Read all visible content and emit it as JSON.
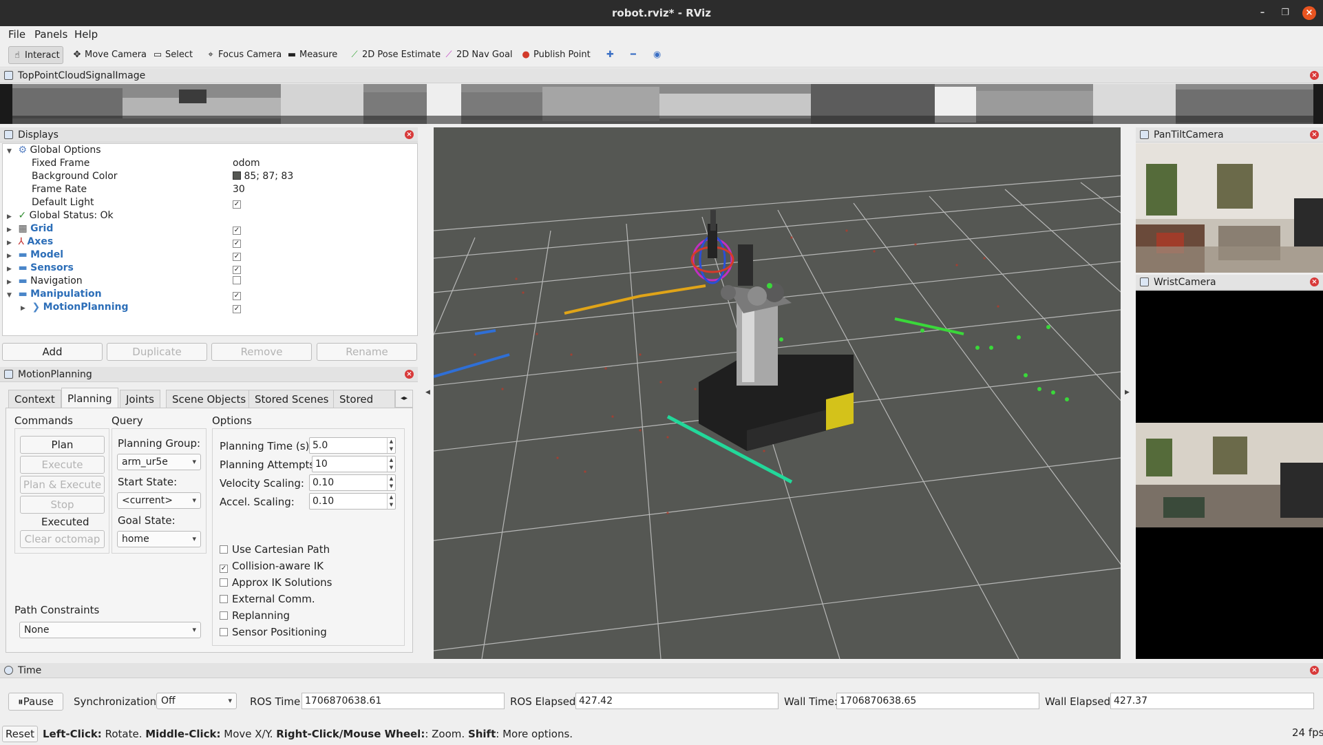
{
  "window": {
    "title": "robot.rviz* - RViz"
  },
  "menu": [
    "File",
    "Panels",
    "Help"
  ],
  "toolbar": {
    "tools": [
      "Interact",
      "Move Camera",
      "Select",
      "Focus Camera",
      "Measure",
      "2D Pose Estimate",
      "2D Nav Goal",
      "Publish Point"
    ],
    "icons": [
      "plus-icon",
      "minus-icon",
      "eye-icon"
    ]
  },
  "image_panel": {
    "title": "TopPointCloudSignalImage"
  },
  "displays": {
    "title": "Displays",
    "global_options": "Global Options",
    "fixed_frame_label": "Fixed Frame",
    "fixed_frame_value": "odom",
    "bg_color_label": "Background Color",
    "bg_color_value": "85; 87; 83",
    "bg_color_hex": "#555753",
    "frame_rate_label": "Frame Rate",
    "frame_rate_value": "30",
    "default_light_label": "Default Light",
    "global_status": "Global Status: Ok",
    "items": [
      "Grid",
      "Axes",
      "Model",
      "Sensors",
      "Navigation",
      "Manipulation"
    ],
    "checked": [
      true,
      true,
      true,
      true,
      false,
      true
    ],
    "sub_item": "MotionPlanning",
    "buttons": [
      "Add",
      "Duplicate",
      "Remove",
      "Rename"
    ]
  },
  "motion_planning": {
    "title": "MotionPlanning",
    "tabs": [
      "Context",
      "Planning",
      "Joints",
      "Scene Objects",
      "Stored Scenes",
      "Stored Stat"
    ],
    "commands_label": "Commands",
    "query_label": "Query",
    "options_label": "Options",
    "commands": [
      "Plan",
      "Execute",
      "Plan & Execute",
      "Stop"
    ],
    "status": "Executed",
    "clear_octomap": "Clear octomap",
    "planning_group_label": "Planning Group:",
    "planning_group": "arm_ur5e",
    "start_state_label": "Start State:",
    "start_state": "<current>",
    "goal_state_label": "Goal State:",
    "goal_state": "home",
    "planning_time_label": "Planning Time (s):",
    "planning_time": "5.0",
    "planning_attempts_label": "Planning Attempts:",
    "planning_attempts": "10",
    "velocity_label": "Velocity Scaling:",
    "velocity": "0.10",
    "accel_label": "Accel. Scaling:",
    "accel": "0.10",
    "checkboxes": [
      "Use Cartesian Path",
      "Collision-aware IK",
      "Approx IK Solutions",
      "External Comm.",
      "Replanning",
      "Sensor Positioning"
    ],
    "checkbox_states": [
      false,
      true,
      false,
      false,
      false,
      false
    ],
    "path_constraints_label": "Path Constraints",
    "path_constraints": "None"
  },
  "cameras": {
    "pantilt": "PanTiltCamera",
    "wrist": "WristCamera"
  },
  "time": {
    "title": "Time",
    "pause": "Pause",
    "sync_label": "Synchronization:",
    "sync_value": "Off",
    "ros_time_label": "ROS Time:",
    "ros_time": "1706870638.61",
    "ros_elapsed_label": "ROS Elapsed:",
    "ros_elapsed": "427.42",
    "wall_time_label": "Wall Time:",
    "wall_time": "1706870638.65",
    "wall_elapsed_label": "Wall Elapsed:",
    "wall_elapsed": "427.37"
  },
  "status": {
    "reset": "Reset",
    "hint_parts": [
      "Left-Click:",
      " Rotate. ",
      "Middle-Click:",
      " Move X/Y. ",
      "Right-Click/Mouse Wheel:",
      ": Zoom. ",
      "Shift",
      ": More options."
    ],
    "fps": "24 fps"
  }
}
